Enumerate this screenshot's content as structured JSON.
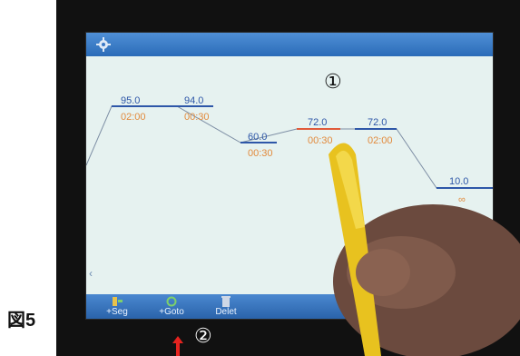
{
  "figure_label": "図5",
  "markers": {
    "one": "①",
    "two": "②"
  },
  "segments": [
    {
      "temp": "95.0",
      "time": "02:00"
    },
    {
      "temp": "94.0",
      "time": "00:30"
    },
    {
      "temp": "60.0",
      "time": "00:30"
    },
    {
      "temp": "72.0",
      "time": "00:30"
    },
    {
      "temp": "72.0",
      "time": "02:00"
    },
    {
      "temp": "10.0",
      "time": "∞"
    }
  ],
  "toolbar": {
    "seg_label": "+Seg",
    "goto_label": "+Goto",
    "delete_label": "Delet"
  },
  "colors": {
    "temp": "#2e57a8",
    "time": "#e28a3c",
    "selected_line": "#e05a3a",
    "bar": "#2b6cb8"
  }
}
